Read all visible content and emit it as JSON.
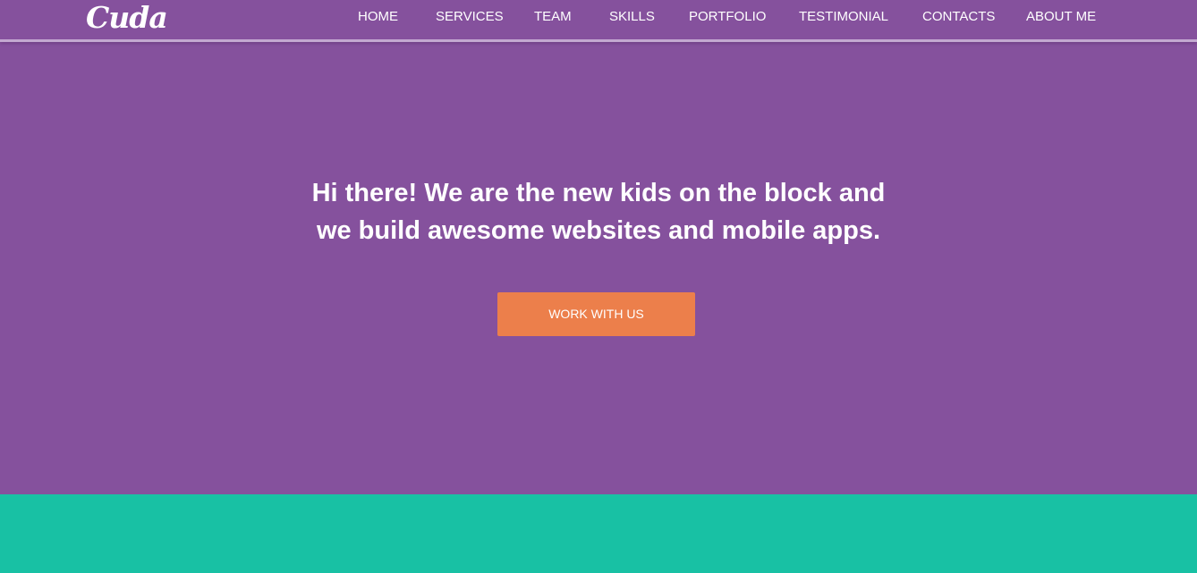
{
  "brand": {
    "logo_text": "Cuda"
  },
  "nav": {
    "items": [
      "HOME",
      "SERVICES",
      "TEAM",
      "SKILLS",
      "PORTFOLIO",
      "TESTIMONIAL",
      "CONTACTS",
      "ABOUT ME"
    ]
  },
  "hero": {
    "headline_line1": "Hi there! We are the new kids on the block and",
    "headline_line2": "we build awesome websites and mobile apps.",
    "cta_label": "WORK WITH US"
  },
  "colors": {
    "hero_background": "#85519d",
    "cta_background": "#ec7f4b",
    "next_section_background": "#18c1a4",
    "text": "#ffffff"
  }
}
